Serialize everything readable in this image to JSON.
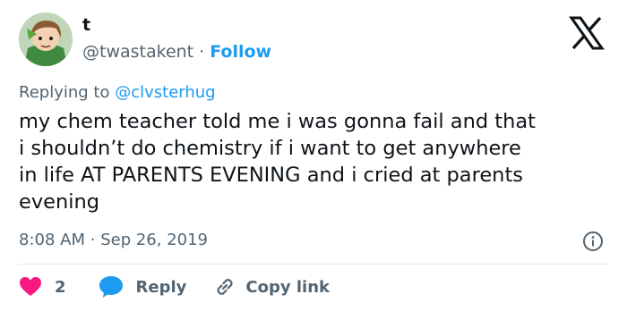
{
  "user": {
    "display_name": "t",
    "handle": "@twastakent",
    "separator": "·",
    "follow_label": "Follow"
  },
  "reply_context": {
    "prefix": "Replying to",
    "mention": "@clvsterhug"
  },
  "tweet": {
    "text": "my chem teacher told me i was gonna fail and that\ni shouldn’t do chemistry if i want to get anywhere\nin life AT PARENTS EVENING and i cried at parents\nevening",
    "time": "8:08 AM",
    "separator": "·",
    "date": "Sep 26, 2019"
  },
  "actions": {
    "like_count": "2",
    "reply_label": "Reply",
    "copy_link_label": "Copy link"
  },
  "colors": {
    "accent": "#1d9bf0",
    "like": "#f91880",
    "text": "#0f1419",
    "muted": "#536471"
  },
  "icons": {
    "logo": "x-logo-icon",
    "info": "info-icon",
    "like": "heart-icon",
    "reply": "speech-bubble-icon",
    "copy": "link-icon"
  }
}
